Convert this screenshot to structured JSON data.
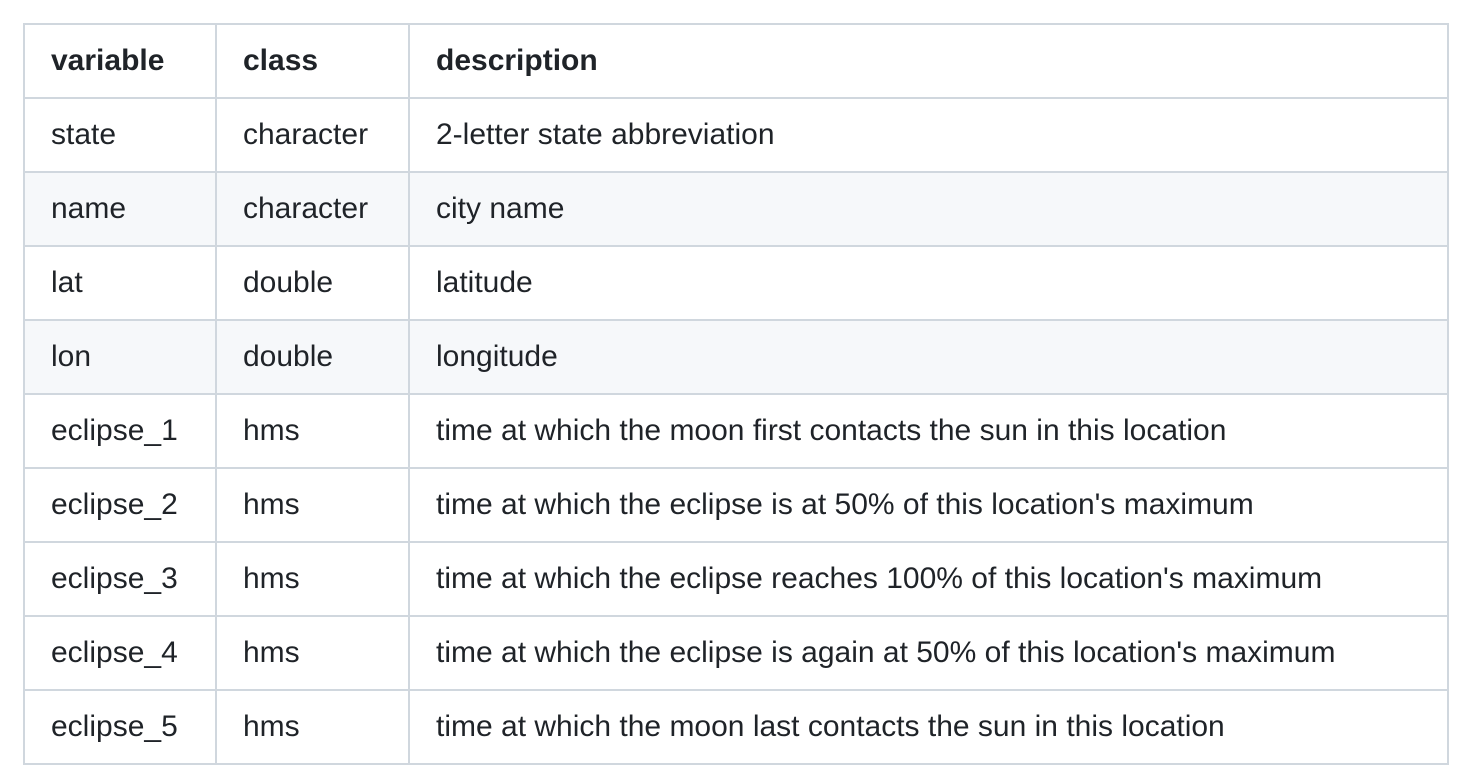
{
  "table": {
    "headers": [
      "variable",
      "class",
      "description"
    ],
    "rows": [
      [
        "state",
        "character",
        "2-letter state abbreviation"
      ],
      [
        "name",
        "character",
        "city name"
      ],
      [
        "lat",
        "double",
        "latitude"
      ],
      [
        "lon",
        "double",
        "longitude"
      ],
      [
        "eclipse_1",
        "hms",
        "time at which the moon first contacts the sun in this location"
      ],
      [
        "eclipse_2",
        "hms",
        "time at which the eclipse is at 50% of this location's maximum"
      ],
      [
        "eclipse_3",
        "hms",
        "time at which the eclipse reaches 100% of this location's maximum"
      ],
      [
        "eclipse_4",
        "hms",
        "time at which the eclipse is again at 50% of this location's maximum"
      ],
      [
        "eclipse_5",
        "hms",
        "time at which the moon last contacts the sun in this location"
      ]
    ]
  }
}
